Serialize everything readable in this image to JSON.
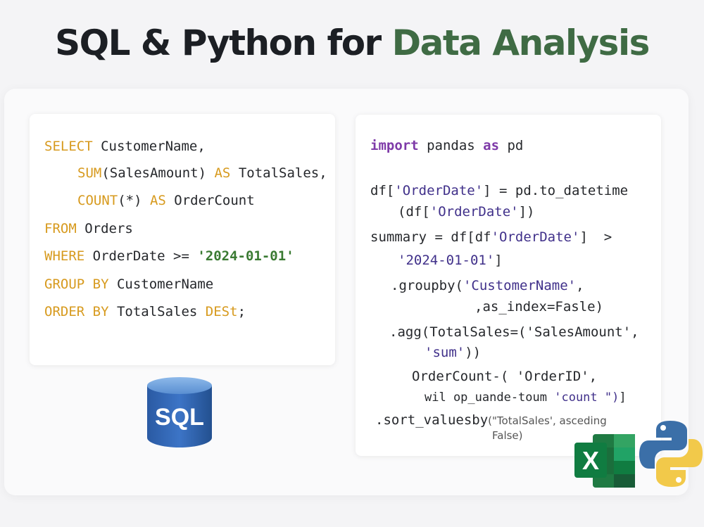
{
  "title": {
    "part1": "SQL & Python for ",
    "part2": "Data Analysis"
  },
  "sql": {
    "l1": {
      "kw": "SELECT",
      "rest": " CustomerName,"
    },
    "l2": {
      "kw1": "SUM",
      "mid": "(SalesAmount) ",
      "kw2": "AS",
      "rest": " TotalSales,"
    },
    "l3": {
      "kw1": "COUNT",
      "mid": "(*) ",
      "kw2": "AS",
      "rest": " OrderCount"
    },
    "l4": {
      "kw": "FROM",
      "rest": " Orders"
    },
    "l5": {
      "kw": "WHERE",
      "rest": " OrderDate >= ",
      "str": "'2024-01-01'"
    },
    "l6": {
      "kw": "GROUP BY",
      "rest": " CustomerName"
    },
    "l7": {
      "kw": "ORDER BY",
      "rest": " TotalSales ",
      "kw2": "DESt",
      "end": ";"
    }
  },
  "python": {
    "l1": {
      "kw1": "import",
      "mid": " pandas ",
      "kw2": "as",
      "rest": " pd"
    },
    "l2": {
      "a": "df[",
      "s": "'OrderDate'",
      "b": "] = pd.to_datetime"
    },
    "l3": {
      "a": "(df[",
      "s": "'OrderDate'",
      "b": "])"
    },
    "l4": {
      "a": "summary = df[df",
      "s": "'OrderDate'",
      "b": "]  >"
    },
    "l5": {
      "s": "'2024-01-01'",
      "b": "]"
    },
    "l6": {
      "a": ".groupby(",
      "s": "'CustomerName'",
      "b": ","
    },
    "l7": {
      "a": ",as_index=Fasle)"
    },
    "l8": {
      "a": ".agg(TotalSales=('SalesAmount'",
      "b": ","
    },
    "l9": {
      "s": "'sum'",
      "b": "))"
    },
    "l10": {
      "a": "OrderCount-( 'OrderID',"
    },
    "l11": {
      "a": "wil op_uande-toum ",
      "s": "'count \")",
      "b": "]"
    },
    "l12": {
      "a": ".sort_valuesby",
      "small": "(\"TotalSales', asceding"
    },
    "l13": {
      "small": "False)"
    }
  },
  "icons": {
    "sql_label": "SQL",
    "excel_letter": "X",
    "colors": {
      "sql": "#2f63b0",
      "excel": "#1f7a43",
      "python_blue": "#3b6fa8",
      "python_yellow": "#f2c94a"
    }
  }
}
